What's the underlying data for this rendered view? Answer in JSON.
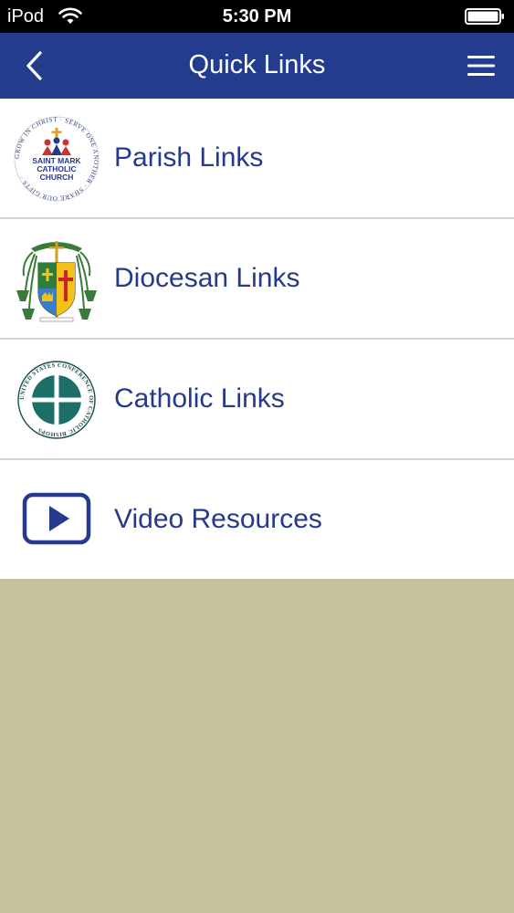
{
  "status_bar": {
    "carrier": "iPod",
    "time": "5:30 PM"
  },
  "nav": {
    "title": "Quick Links"
  },
  "list": {
    "items": [
      {
        "label": "Parish Links",
        "icon": "saint-mark-parish-logo"
      },
      {
        "label": "Diocesan Links",
        "icon": "diocesan-coat-of-arms"
      },
      {
        "label": "Catholic Links",
        "icon": "usccb-logo"
      },
      {
        "label": "Video Resources",
        "icon": "video-play-icon"
      }
    ]
  },
  "logo_text": {
    "parish": [
      "SAINT MARK",
      "CATHOLIC",
      "CHURCH"
    ],
    "parish_ring": "GROW IN CHRIST · SERVE ONE ANOTHER · SHARE OUR GIFTS ·",
    "usccb_ring": "UNITED STATES CONFERENCE OF CATHOLIC BISHOPS"
  },
  "colors": {
    "status_bar": "#000000",
    "nav_bar": "#243c8e",
    "label_text": "#26398c",
    "background": "#c5c19e",
    "divider": "#d3d3d3"
  }
}
